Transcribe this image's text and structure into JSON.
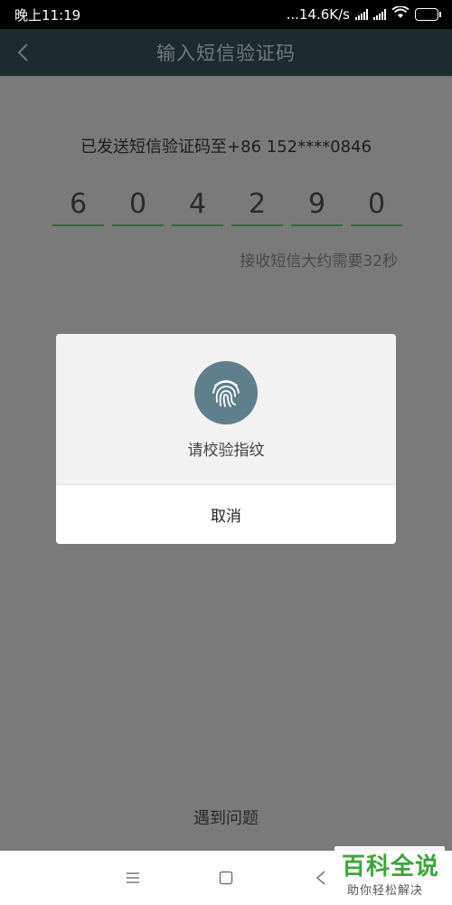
{
  "status_bar": {
    "time": "晚上11:19",
    "net_speed": "...14.6K/s",
    "battery_level": "33",
    "battery_fill_fraction": 0.33
  },
  "header": {
    "title": "输入短信验证码",
    "back_icon": "chevron-left-icon"
  },
  "main": {
    "sent_message": "已发送短信验证码至+86 152****0846",
    "code_digits": [
      "6",
      "0",
      "4",
      "2",
      "9",
      "0"
    ],
    "timer_message": "接收短信大约需要32秒",
    "help_link": "遇到问题"
  },
  "dialog": {
    "icon": "fingerprint-icon",
    "message": "请校验指纹",
    "cancel_label": "取消"
  },
  "nav_bar": {
    "menu_icon": "menu-icon",
    "home_icon": "home-square-icon",
    "back_icon": "back-triangle-icon"
  },
  "watermark": {
    "title": "百科全说",
    "subtitle": "助你轻松解决"
  },
  "colors": {
    "header_bg": "#1d2a2e",
    "overlay_bg": "#7a7a7a",
    "code_underline": "#2c6e3b",
    "fingerprint_bg": "#5f7f8c",
    "watermark_green": "#3aa63a"
  }
}
